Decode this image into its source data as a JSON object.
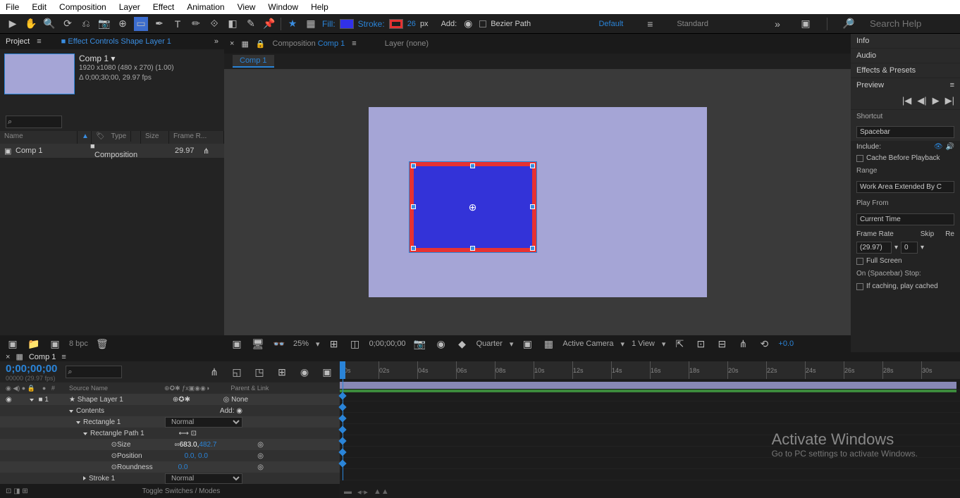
{
  "menubar": [
    "File",
    "Edit",
    "Composition",
    "Layer",
    "Effect",
    "Animation",
    "View",
    "Window",
    "Help"
  ],
  "toolbar": {
    "fill_label": "Fill:",
    "stroke_label": "Stroke:",
    "stroke_px": "26",
    "px": "px",
    "add_label": "Add:",
    "bezier": "Bezier Path",
    "ws1": "Default",
    "ws2": "Standard",
    "search_ph": "Search Help"
  },
  "project": {
    "tab_project": "Project",
    "tab_fx": "Effect Controls Shape Layer 1",
    "comp_name": "Comp 1 ▾",
    "dims": "1920 x1080  (480 x 270) (1.00)",
    "duration": "Δ 0;00;30;00, 29.97 fps",
    "hdr_name": "Name",
    "hdr_type": "Type",
    "hdr_size": "Size",
    "hdr_fr": "Frame R...",
    "row_name": "Comp 1",
    "row_type": "Composition",
    "row_fr": "29.97",
    "bpc": "8 bpc"
  },
  "viewer": {
    "comp_label": "Composition",
    "comp_name": "Comp 1",
    "layer_none": "Layer  (none)",
    "subtab": "Comp 1",
    "zoom": "25%",
    "timecode": "0;00;00;00",
    "quality": "Quarter",
    "camera": "Active Camera",
    "views": "1 View",
    "exposure": "+0.0"
  },
  "right": {
    "info": "Info",
    "audio": "Audio",
    "fx": "Effects & Presets",
    "preview": "Preview",
    "shortcut": "Shortcut",
    "spacebar": "Spacebar",
    "include": "Include:",
    "cache": "Cache Before Playback",
    "range": "Range",
    "range_val": "Work Area Extended By C",
    "playfrom": "Play From",
    "current": "Current Time",
    "framerate": "Frame Rate",
    "skip": "Skip",
    "re": "Re",
    "fr_val": "(29.97)",
    "skip_val": "0",
    "fullscreen": "Full Screen",
    "onstop": "On (Spacebar) Stop:",
    "ifcache": "If caching, play cached"
  },
  "timeline": {
    "tab": "Comp 1",
    "timecode": "0;00;00;00",
    "frame": "00000 (29.97 fps)",
    "hdr_src": "Source Name",
    "hdr_parent": "Parent & Link",
    "shape_layer": "Shape Layer 1",
    "shape_parent": "None",
    "contents": "Contents",
    "add": "Add:",
    "rect1": "Rectangle 1",
    "normal": "Normal",
    "rectpath": "Rectangle Path 1",
    "size": "Size",
    "size_v1": "683.0,",
    "size_v2": "482.7",
    "position": "Position",
    "pos_v": "0.0, 0.0",
    "roundness": "Roundness",
    "round_v": "0.0",
    "stroke1": "Stroke 1",
    "toggle": "Toggle Switches / Modes",
    "ticks": [
      "00s",
      "02s",
      "04s",
      "06s",
      "08s",
      "10s",
      "12s",
      "14s",
      "16s",
      "18s",
      "20s",
      "22s",
      "24s",
      "26s",
      "28s",
      "30s"
    ]
  },
  "watermark": {
    "big": "Activate Windows",
    "small": "Go to PC settings to activate Windows."
  }
}
